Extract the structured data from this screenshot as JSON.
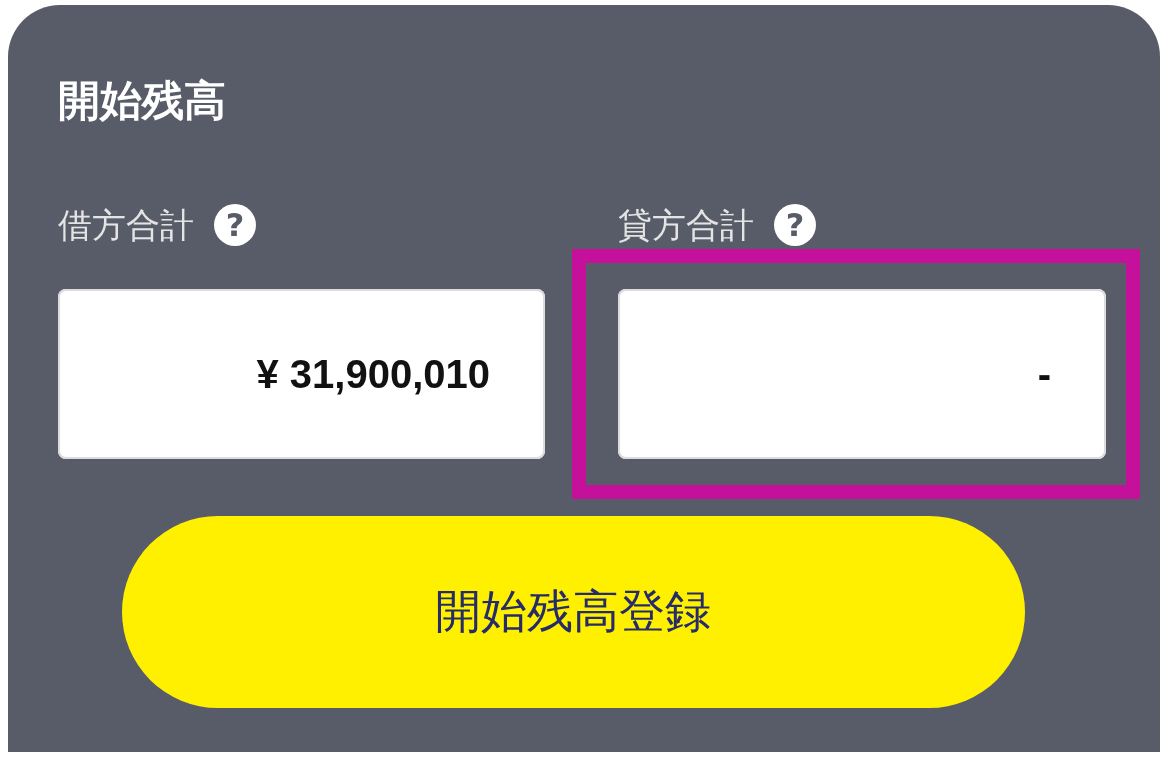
{
  "card": {
    "title": "開始残高"
  },
  "totals": [
    {
      "label": "借方合計",
      "help": "?",
      "value": "¥ 31,900,010",
      "highlighted": false
    },
    {
      "label": "貸方合計",
      "help": "?",
      "value": "-",
      "highlighted": true
    }
  ],
  "button": {
    "label": "開始残高登録"
  }
}
